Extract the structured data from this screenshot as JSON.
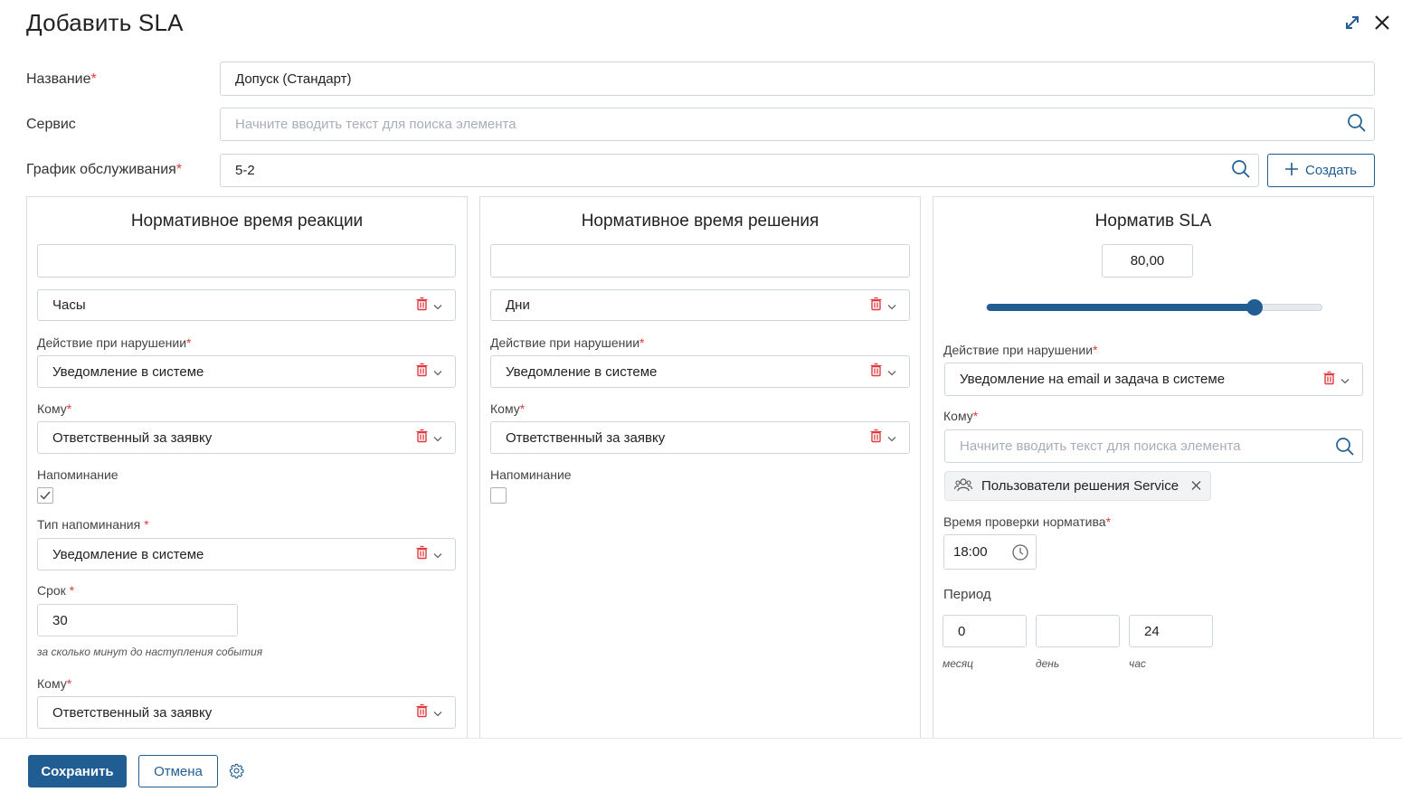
{
  "dialog": {
    "title": "Добавить SLA"
  },
  "form": {
    "name": {
      "label": "Название",
      "value": "Допуск (Стандарт)"
    },
    "service": {
      "label": "Сервис",
      "placeholder": "Начните вводить текст для поиска элемента"
    },
    "schedule": {
      "label": "График обслуживания",
      "value": "5-2",
      "create_label": "Создать"
    },
    "required_mark": "*"
  },
  "reaction": {
    "title": "Нормативное время реакции",
    "time_value": "",
    "unit": "Часы",
    "action_label": "Действие при нарушении",
    "action_value": "Уведомление в системе",
    "to_label": "Кому",
    "to_value": "Ответственный за заявку",
    "reminder_label": "Напоминание",
    "reminder_checked": true,
    "reminder_type_label": "Тип напоминания ",
    "reminder_type_value": "Уведомление в системе",
    "term_label": "Срок ",
    "term_value": "30",
    "term_hint": "за сколько минут до наступления события",
    "to2_label": "Кому",
    "to2_value": "Ответственный за заявку"
  },
  "resolution": {
    "title": "Нормативное время решения",
    "time_value": "",
    "unit": "Дни",
    "action_label": "Действие при нарушении",
    "action_value": "Уведомление в системе",
    "to_label": "Кому",
    "to_value": "Ответственный за заявку",
    "reminder_label": "Напоминание",
    "reminder_checked": false
  },
  "sla": {
    "title": "Норматив SLA",
    "value": "80,00",
    "slider_percent": 80,
    "action_label": "Действие при нарушении",
    "action_value": "Уведомление на email и задача в системе",
    "to_label": "Кому",
    "to_placeholder": "Начните вводить текст для поиска элемента",
    "chip_label": "Пользователи решения Service",
    "check_time_label": "Время проверки норматива",
    "check_time_value": "18:00",
    "period_label": "Период",
    "period": [
      {
        "value": "0",
        "caption": "месяц"
      },
      {
        "value": "",
        "caption": "день"
      },
      {
        "value": "24",
        "caption": "час"
      }
    ]
  },
  "footer": {
    "save_label": "Сохранить",
    "cancel_label": "Отмена"
  },
  "colors": {
    "accent": "#1f5d93",
    "required": "#e0393e",
    "delete_icon": "#e0393e"
  }
}
